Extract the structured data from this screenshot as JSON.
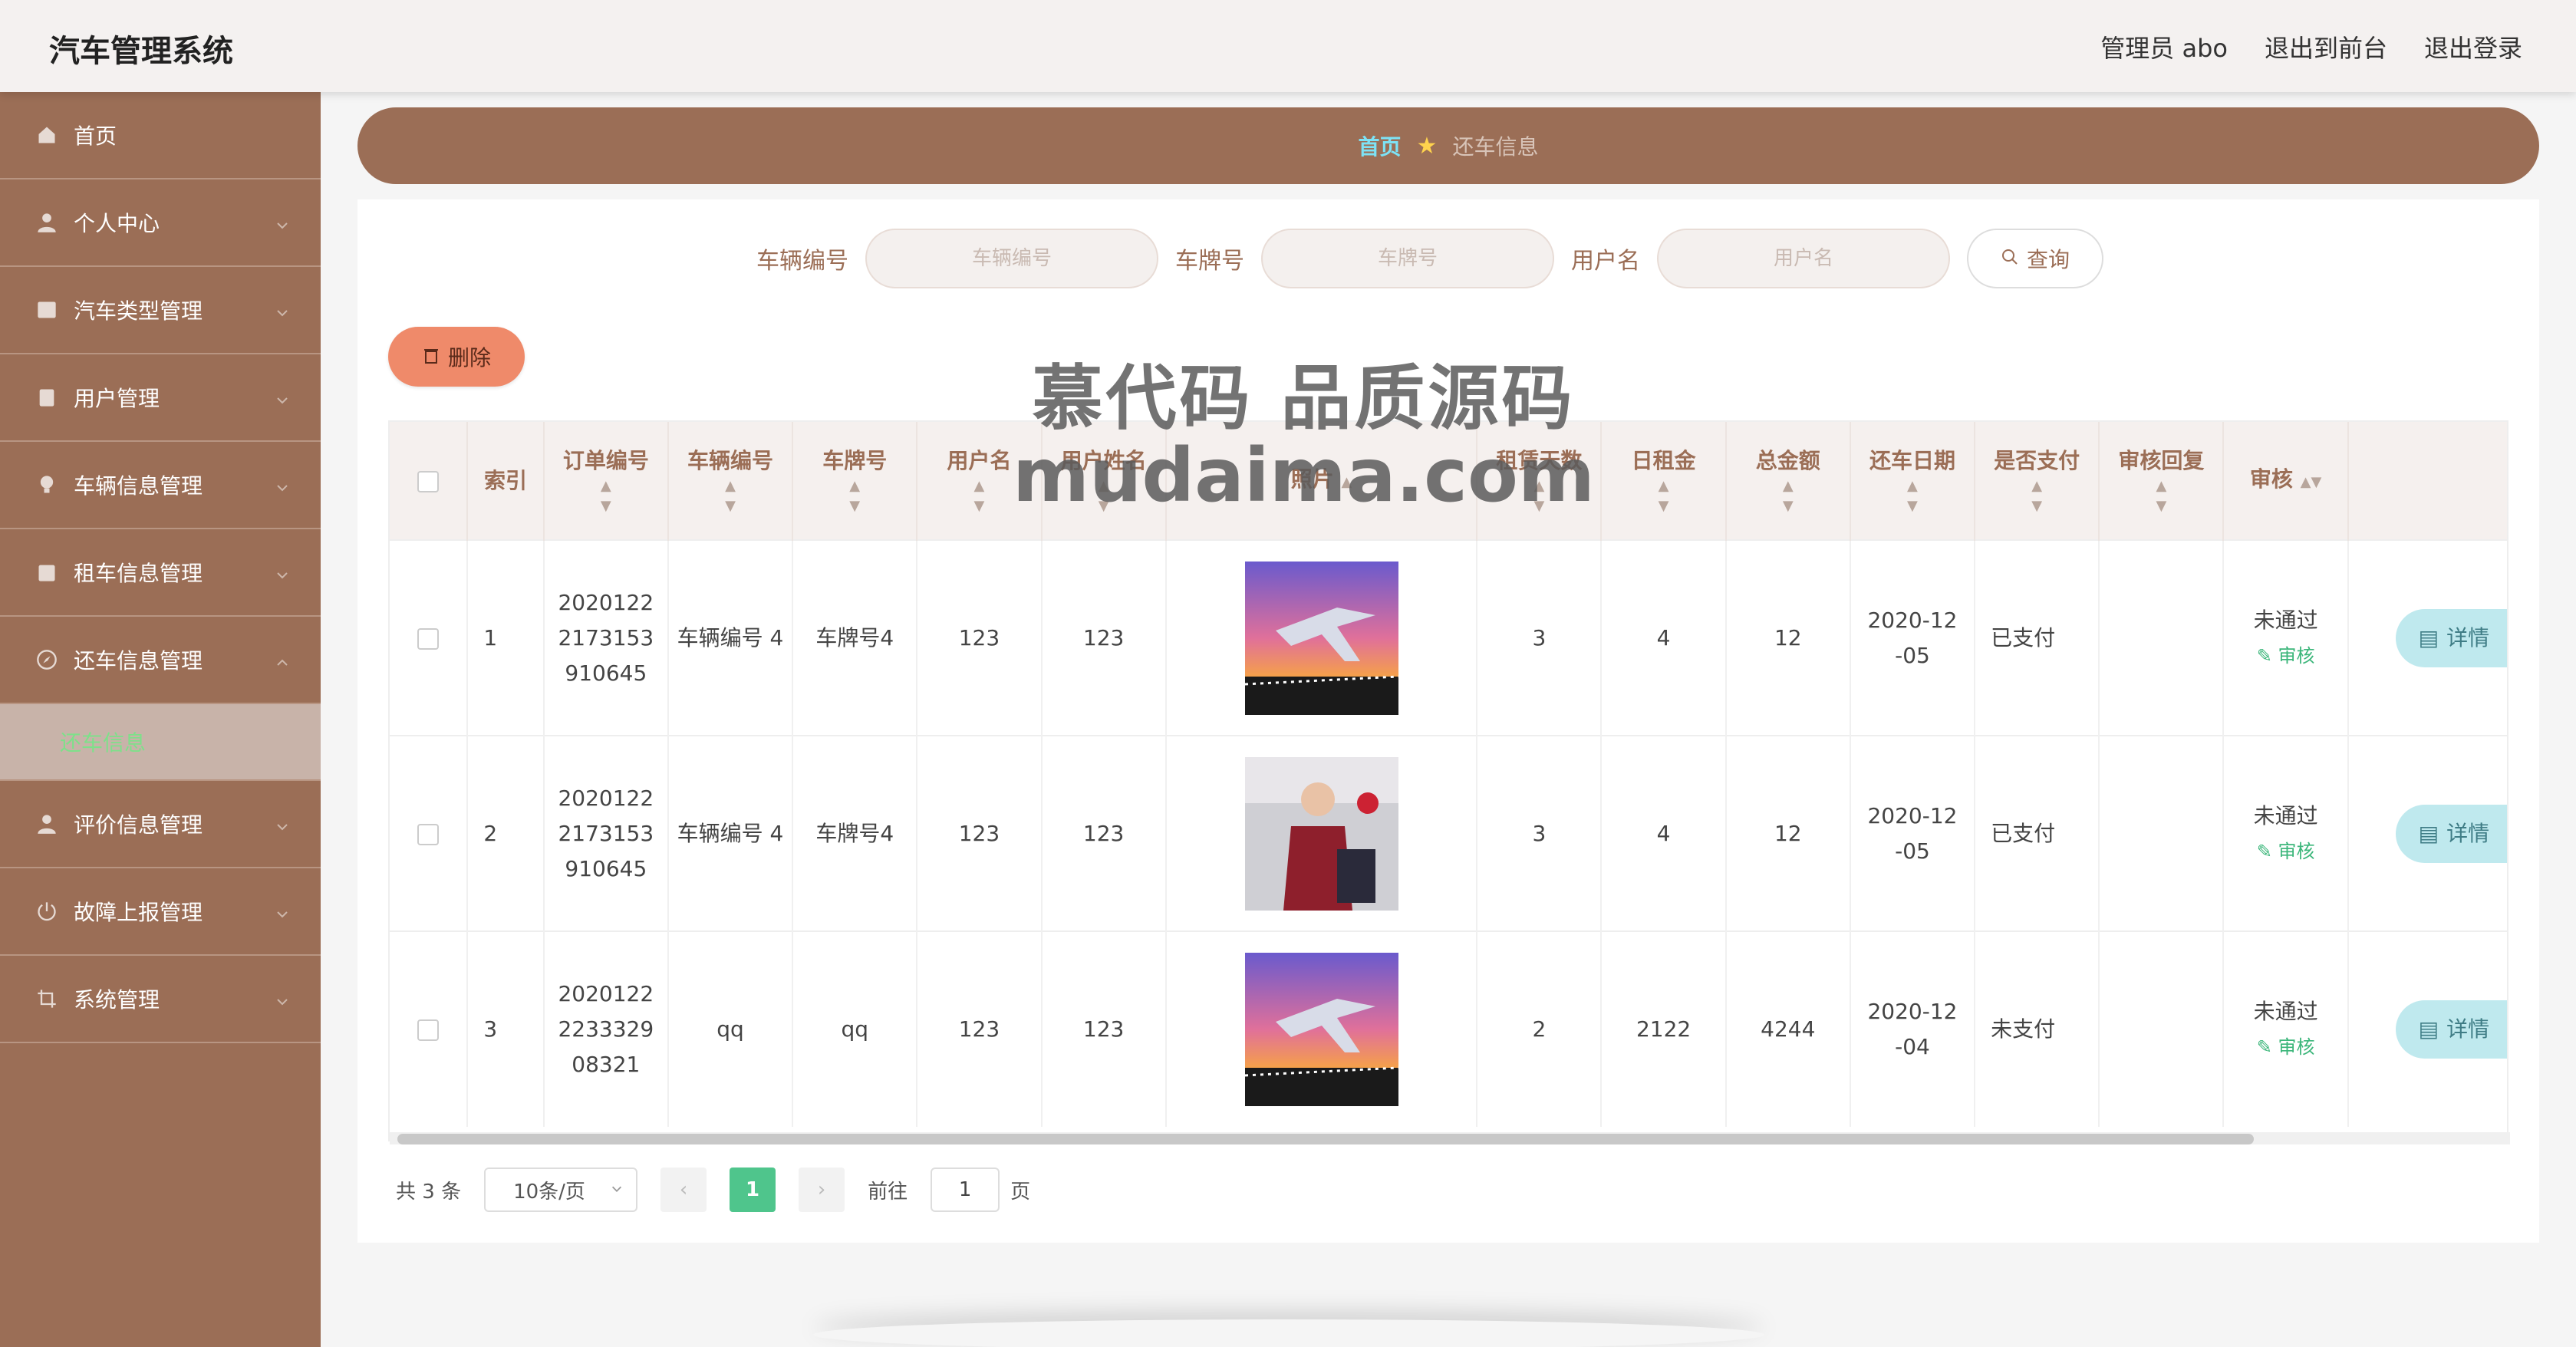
{
  "app": {
    "title": "汽车管理系统"
  },
  "header": {
    "admin_label": "管理员 abo",
    "to_front": "退出到前台",
    "logout": "退出登录"
  },
  "sidebar": {
    "items": [
      {
        "label": "首页",
        "icon": "home-icon"
      },
      {
        "label": "个人中心",
        "icon": "user-icon"
      },
      {
        "label": "汽车类型管理",
        "icon": "list-icon"
      },
      {
        "label": "用户管理",
        "icon": "clipboard-icon"
      },
      {
        "label": "车辆信息管理",
        "icon": "bulb-icon"
      },
      {
        "label": "租车信息管理",
        "icon": "calendar-icon"
      },
      {
        "label": "还车信息管理",
        "icon": "compass-icon"
      },
      {
        "label": "评价信息管理",
        "icon": "user-icon"
      },
      {
        "label": "故障上报管理",
        "icon": "power-icon"
      },
      {
        "label": "系统管理",
        "icon": "crop-icon"
      }
    ],
    "active_sub": "还车信息"
  },
  "breadcrumb": {
    "home": "首页",
    "current": "还车信息"
  },
  "search": {
    "vehicle_no_label": "车辆编号",
    "vehicle_no_placeholder": "车辆编号",
    "plate_label": "车牌号",
    "plate_placeholder": "车牌号",
    "username_label": "用户名",
    "username_placeholder": "用户名",
    "query_label": "查询"
  },
  "actions": {
    "delete_label": "删除",
    "audit_label": "审核",
    "detail_label": "详情"
  },
  "table": {
    "headers": {
      "index": "索引",
      "order_no": "订单编号",
      "vehicle_no": "车辆编号",
      "plate": "车牌号",
      "username": "用户名",
      "user_realname": "用户姓名",
      "photo": "照片",
      "days": "租赁天数",
      "daily_rent": "日租金",
      "total": "总金额",
      "return_date": "还车日期",
      "paid": "是否支付",
      "audit_reply": "审核回复",
      "audit": "审核"
    },
    "rows": [
      {
        "index": "1",
        "order_no": "2020122 2173153 910645",
        "vehicle_no": "车辆编号 4",
        "plate": "车牌号4",
        "username": "123",
        "realname": "123",
        "photo": "airplane-photo",
        "days": "3",
        "daily": "4",
        "total": "12",
        "date": "2020-12 -05",
        "paid": "已支付",
        "reply": "",
        "status": "未通过"
      },
      {
        "index": "2",
        "order_no": "2020122 2173153 910645",
        "vehicle_no": "车辆编号 4",
        "plate": "车牌号4",
        "username": "123",
        "realname": "123",
        "photo": "attendant-photo",
        "days": "3",
        "daily": "4",
        "total": "12",
        "date": "2020-12 -05",
        "paid": "已支付",
        "reply": "",
        "status": "未通过"
      },
      {
        "index": "3",
        "order_no": "2020122 2233329 08321",
        "vehicle_no": "qq",
        "plate": "qq",
        "username": "123",
        "realname": "123",
        "photo": "airplane-photo",
        "days": "2",
        "daily": "2122",
        "total": "4244",
        "date": "2020-12 -04",
        "paid": "未支付",
        "reply": "",
        "status": "未通过"
      }
    ]
  },
  "pagination": {
    "total_text": "共 3 条",
    "page_size": "10条/页",
    "current_page": "1",
    "goto_label": "前往",
    "goto_value": "1",
    "page_suffix": "页"
  },
  "watermark": {
    "line1": "慕代码 品质源码",
    "line2": "mudaima.com"
  },
  "colors": {
    "brand": "#9b6e56",
    "accent_green": "#4fc58c",
    "delete": "#ef8a6a",
    "detail": "#bfe9ee"
  }
}
